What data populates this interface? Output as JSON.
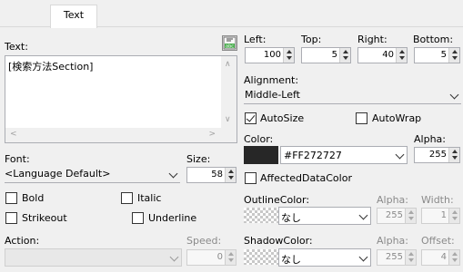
{
  "tab": {
    "label": "Text"
  },
  "text_section": {
    "label": "Text:",
    "content": "[検索方法Section]"
  },
  "font": {
    "label": "Font:",
    "value": "<Language Default>",
    "size_label": "Size:",
    "size": "58"
  },
  "styles": {
    "bold": "Bold",
    "italic": "Italic",
    "strikeout": "Strikeout",
    "underline": "Underline"
  },
  "action": {
    "label": "Action:",
    "speed_label": "Speed:",
    "speed": "0"
  },
  "margins": {
    "left_label": "Left:",
    "left": "100",
    "top_label": "Top:",
    "top": "5",
    "right_label": "Right:",
    "right": "40",
    "bottom_label": "Bottom:",
    "bottom": "5"
  },
  "alignment": {
    "label": "Alignment:",
    "value": "Middle-Left"
  },
  "autosize": {
    "label": "AutoSize",
    "checked": true
  },
  "autowrap": {
    "label": "AutoWrap",
    "checked": false
  },
  "color": {
    "label": "Color:",
    "value": "#FF272727",
    "swatch": "#272727",
    "alpha_label": "Alpha:",
    "alpha": "255"
  },
  "affected": {
    "label": "AffectedDataColor",
    "checked": false
  },
  "outline": {
    "label": "OutlineColor:",
    "value": "なし",
    "alpha_label": "Alpha:",
    "alpha": "255",
    "width_label": "Width:",
    "width": "1"
  },
  "shadow": {
    "label": "ShadowColor:",
    "value": "なし",
    "alpha_label": "Alpha:",
    "alpha": "255",
    "offset_label": "Offset:",
    "offset": "4"
  },
  "icons": {
    "insert": "insert-field-icon"
  }
}
